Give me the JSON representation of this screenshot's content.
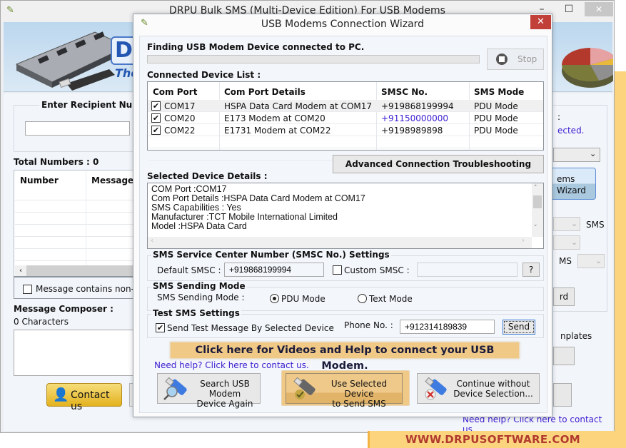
{
  "main_window": {
    "title": "DRPU Bulk SMS (Multi-Device Edition) For USB Modems",
    "controls": {
      "minimize": "–",
      "maximize": "☐",
      "close": "✕"
    },
    "banner": {
      "logo_partial": "DI",
      "tagline_partial": "The"
    },
    "left": {
      "recipient_group_title": "Enter Recipient Num",
      "recipient_input_value": "",
      "total_numbers_label": "Total Numbers : 0",
      "grid_headers": [
        "Number",
        "Message"
      ],
      "non_english_checkbox_label": "Message contains non-En",
      "non_english_checked": false,
      "composer_label": "Message Composer :",
      "char_count": "0 Characters",
      "contact_button": "Contact us"
    },
    "right_partial": {
      "colon": ":",
      "selected_text": "ected.",
      "wizard_button_line1": "ems",
      "wizard_button_line2": "Wizard",
      "sms_label_1": "SMS",
      "sms_label_2": "MS",
      "button_partial": "rd",
      "templates_partial": "nplates"
    },
    "bottom_link": "Need help? Click here to contact us.",
    "footer_brand": "WWW.DRPUSOFTWARE.COM"
  },
  "dialog": {
    "title": "USB Modems Connection Wizard",
    "close": "✕",
    "finding_label": "Finding USB Modem Device connected to PC.",
    "progress_fraction": 0,
    "stop_button": "Stop",
    "device_list_label": "Connected Device List :",
    "device_table": {
      "headers": [
        "Com Port",
        "Com Port Details",
        "SMSC No.",
        "SMS Mode"
      ],
      "rows": [
        {
          "checked": true,
          "port": "COM17",
          "details": "HSPA Data Card Modem at COM17",
          "smsc": "+919868199994",
          "mode": "PDU Mode",
          "smsc_highlight": false
        },
        {
          "checked": true,
          "port": "COM20",
          "details": "E173 Modem at COM20",
          "smsc": "+91150000000",
          "mode": "PDU Mode",
          "smsc_highlight": true
        },
        {
          "checked": true,
          "port": "COM22",
          "details": "E1731 Modem at COM22",
          "smsc": "+9198989898",
          "mode": "PDU Mode",
          "smsc_highlight": false
        }
      ]
    },
    "advanced_button": "Advanced Connection Troubleshooting",
    "selected_details_label": "Selected Device Details :",
    "selected_details_lines": [
      "COM Port :COM17",
      "Com Port Details :HSPA Data Card Modem at COM17",
      "SMS Capabilities : Yes",
      "Manufacturer :TCT Mobile International Limited",
      "Model :HSPA Data Card"
    ],
    "smsc_settings": {
      "title": "SMS Service Center Number (SMSC No.) Settings",
      "default_label": "Default SMSC :",
      "default_value": "+919868199994",
      "custom_label": "Custom SMSC :",
      "custom_checked": false,
      "custom_value": "",
      "help_button": "?"
    },
    "sending_mode": {
      "title": "SMS Sending Mode",
      "label": "SMS Sending Mode :",
      "options": [
        "PDU Mode",
        "Text Mode"
      ],
      "selected": "PDU Mode"
    },
    "test_sms": {
      "title": "Test SMS Settings",
      "checkbox_label": "Send Test Message By Selected Device",
      "checked": true,
      "phone_label": "Phone No. :",
      "phone_value": "+912314189839",
      "send_button": "Send"
    },
    "videos_banner": "Click here for Videos and Help to connect your USB Modem.",
    "help_link": "Need help? Click here to contact us.",
    "actions": [
      {
        "line1": "Search USB Modem",
        "line2": "Device Again",
        "icon": "usb-search-icon"
      },
      {
        "line1": "Use Selected Device",
        "line2": "to Send SMS",
        "icon": "usb-check-icon"
      },
      {
        "line1": "Continue without",
        "line2": "Device Selection...",
        "icon": "usb-cancel-icon"
      }
    ]
  },
  "colors": {
    "accent_link": "#3b1dd1",
    "close_red": "#c1403a",
    "highlight_orange": "#f0c987",
    "brand_footer": "#b03a2e",
    "footer_bg": "#fdd47e"
  }
}
